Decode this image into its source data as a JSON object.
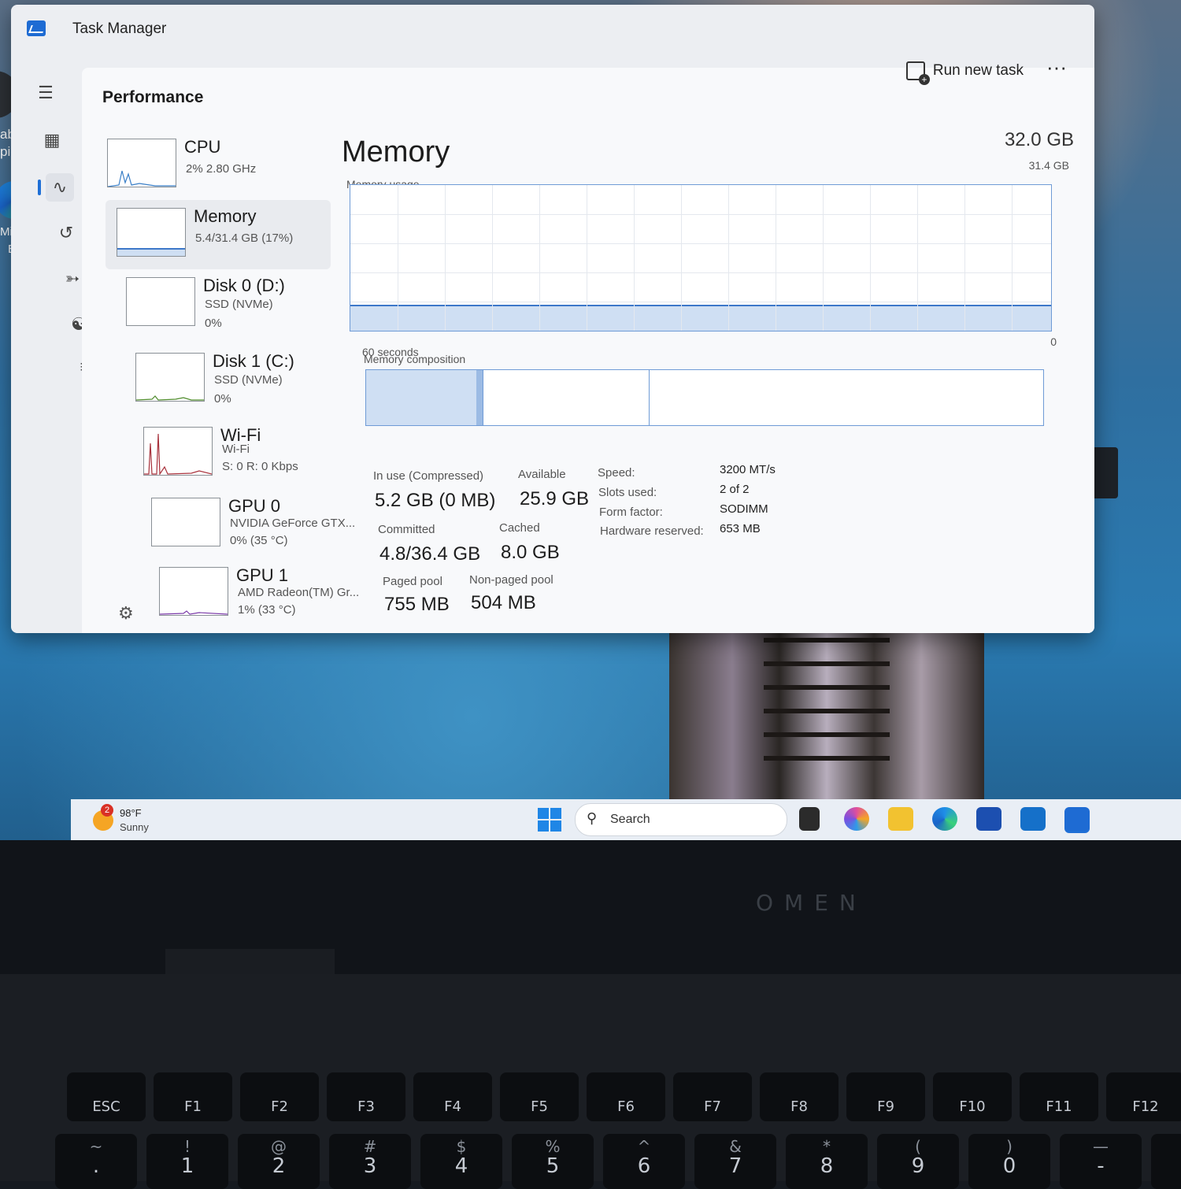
{
  "window": {
    "title": "Task Manager",
    "page": "Performance",
    "run_new_task": "Run new task",
    "more": "···"
  },
  "desktop": {
    "side_text_1": "abo",
    "side_text_2": "pictu",
    "edge_label_1": "Microsof",
    "edge_label_2": "Edge"
  },
  "rail": [
    "menu-icon",
    "processes-icon",
    "performance-icon",
    "app-history-icon",
    "startup-apps-icon",
    "users-icon",
    "details-icon",
    "services-icon",
    "settings-icon"
  ],
  "perf_list": [
    {
      "name": "CPU",
      "line1": "2%  2.80 GHz",
      "line2": ""
    },
    {
      "name": "Memory",
      "line1": "5.4/31.4 GB (17%)",
      "line2": ""
    },
    {
      "name": "Disk 0 (D:)",
      "line1": "SSD (NVMe)",
      "line2": "0%"
    },
    {
      "name": "Disk 1 (C:)",
      "line1": "SSD (NVMe)",
      "line2": "0%"
    },
    {
      "name": "Wi-Fi",
      "line1": "Wi-Fi",
      "line2": "S: 0  R: 0 Kbps"
    },
    {
      "name": "GPU 0",
      "line1": "NVIDIA GeForce GTX...",
      "line2": "0%  (35 °C)"
    },
    {
      "name": "GPU 1",
      "line1": "AMD Radeon(TM) Gr...",
      "line2": "1%  (33 °C)"
    }
  ],
  "memory": {
    "title": "Memory",
    "total": "32.0 GB",
    "graph_max": "31.4 GB",
    "usage_label": "Memory usage",
    "graph_min": "0",
    "time_span": "60 seconds",
    "composition_label": "Memory composition",
    "usage_fraction": 0.17,
    "stats": {
      "in_use_label": "In use (Compressed)",
      "in_use": "5.2 GB (0 MB)",
      "available_label": "Available",
      "available": "25.9 GB",
      "committed_label": "Committed",
      "committed": "4.8/36.4 GB",
      "cached_label": "Cached",
      "cached": "8.0 GB",
      "paged_label": "Paged pool",
      "paged": "755 MB",
      "nonpaged_label": "Non-paged pool",
      "nonpaged": "504 MB"
    },
    "specs": {
      "speed_label": "Speed:",
      "speed": "3200 MT/s",
      "slots_label": "Slots used:",
      "slots": "2 of 2",
      "form_label": "Form factor:",
      "form": "SODIMM",
      "reserved_label": "Hardware reserved:",
      "reserved": "653 MB"
    }
  },
  "taskbar": {
    "weather_badge": "2",
    "temperature": "98°F",
    "condition": "Sunny",
    "search_placeholder": "Search"
  },
  "laptop": {
    "brand": "OMEN",
    "fn_keys": [
      "ESC",
      "F1",
      "F2",
      "F3",
      "F4",
      "F5",
      "F6",
      "F7",
      "F8",
      "F9",
      "F10",
      "F11",
      "F12"
    ],
    "num_keys": [
      {
        "top": "~",
        "main": "."
      },
      {
        "top": "!",
        "main": "1"
      },
      {
        "top": "@",
        "main": "2"
      },
      {
        "top": "#",
        "main": "3"
      },
      {
        "top": "$",
        "main": "4"
      },
      {
        "top": "%",
        "main": "5"
      },
      {
        "top": "^",
        "main": "6"
      },
      {
        "top": "&",
        "main": "7"
      },
      {
        "top": "*",
        "main": "8"
      },
      {
        "top": "(",
        "main": "9"
      },
      {
        "top": ")",
        "main": "0"
      },
      {
        "top": "—",
        "main": "-"
      },
      {
        "top": "+",
        "main": ""
      }
    ]
  },
  "colors": {
    "accent": "#1f6fd6",
    "graph_fill": "#cfdff3",
    "graph_line": "#3d78c9"
  }
}
